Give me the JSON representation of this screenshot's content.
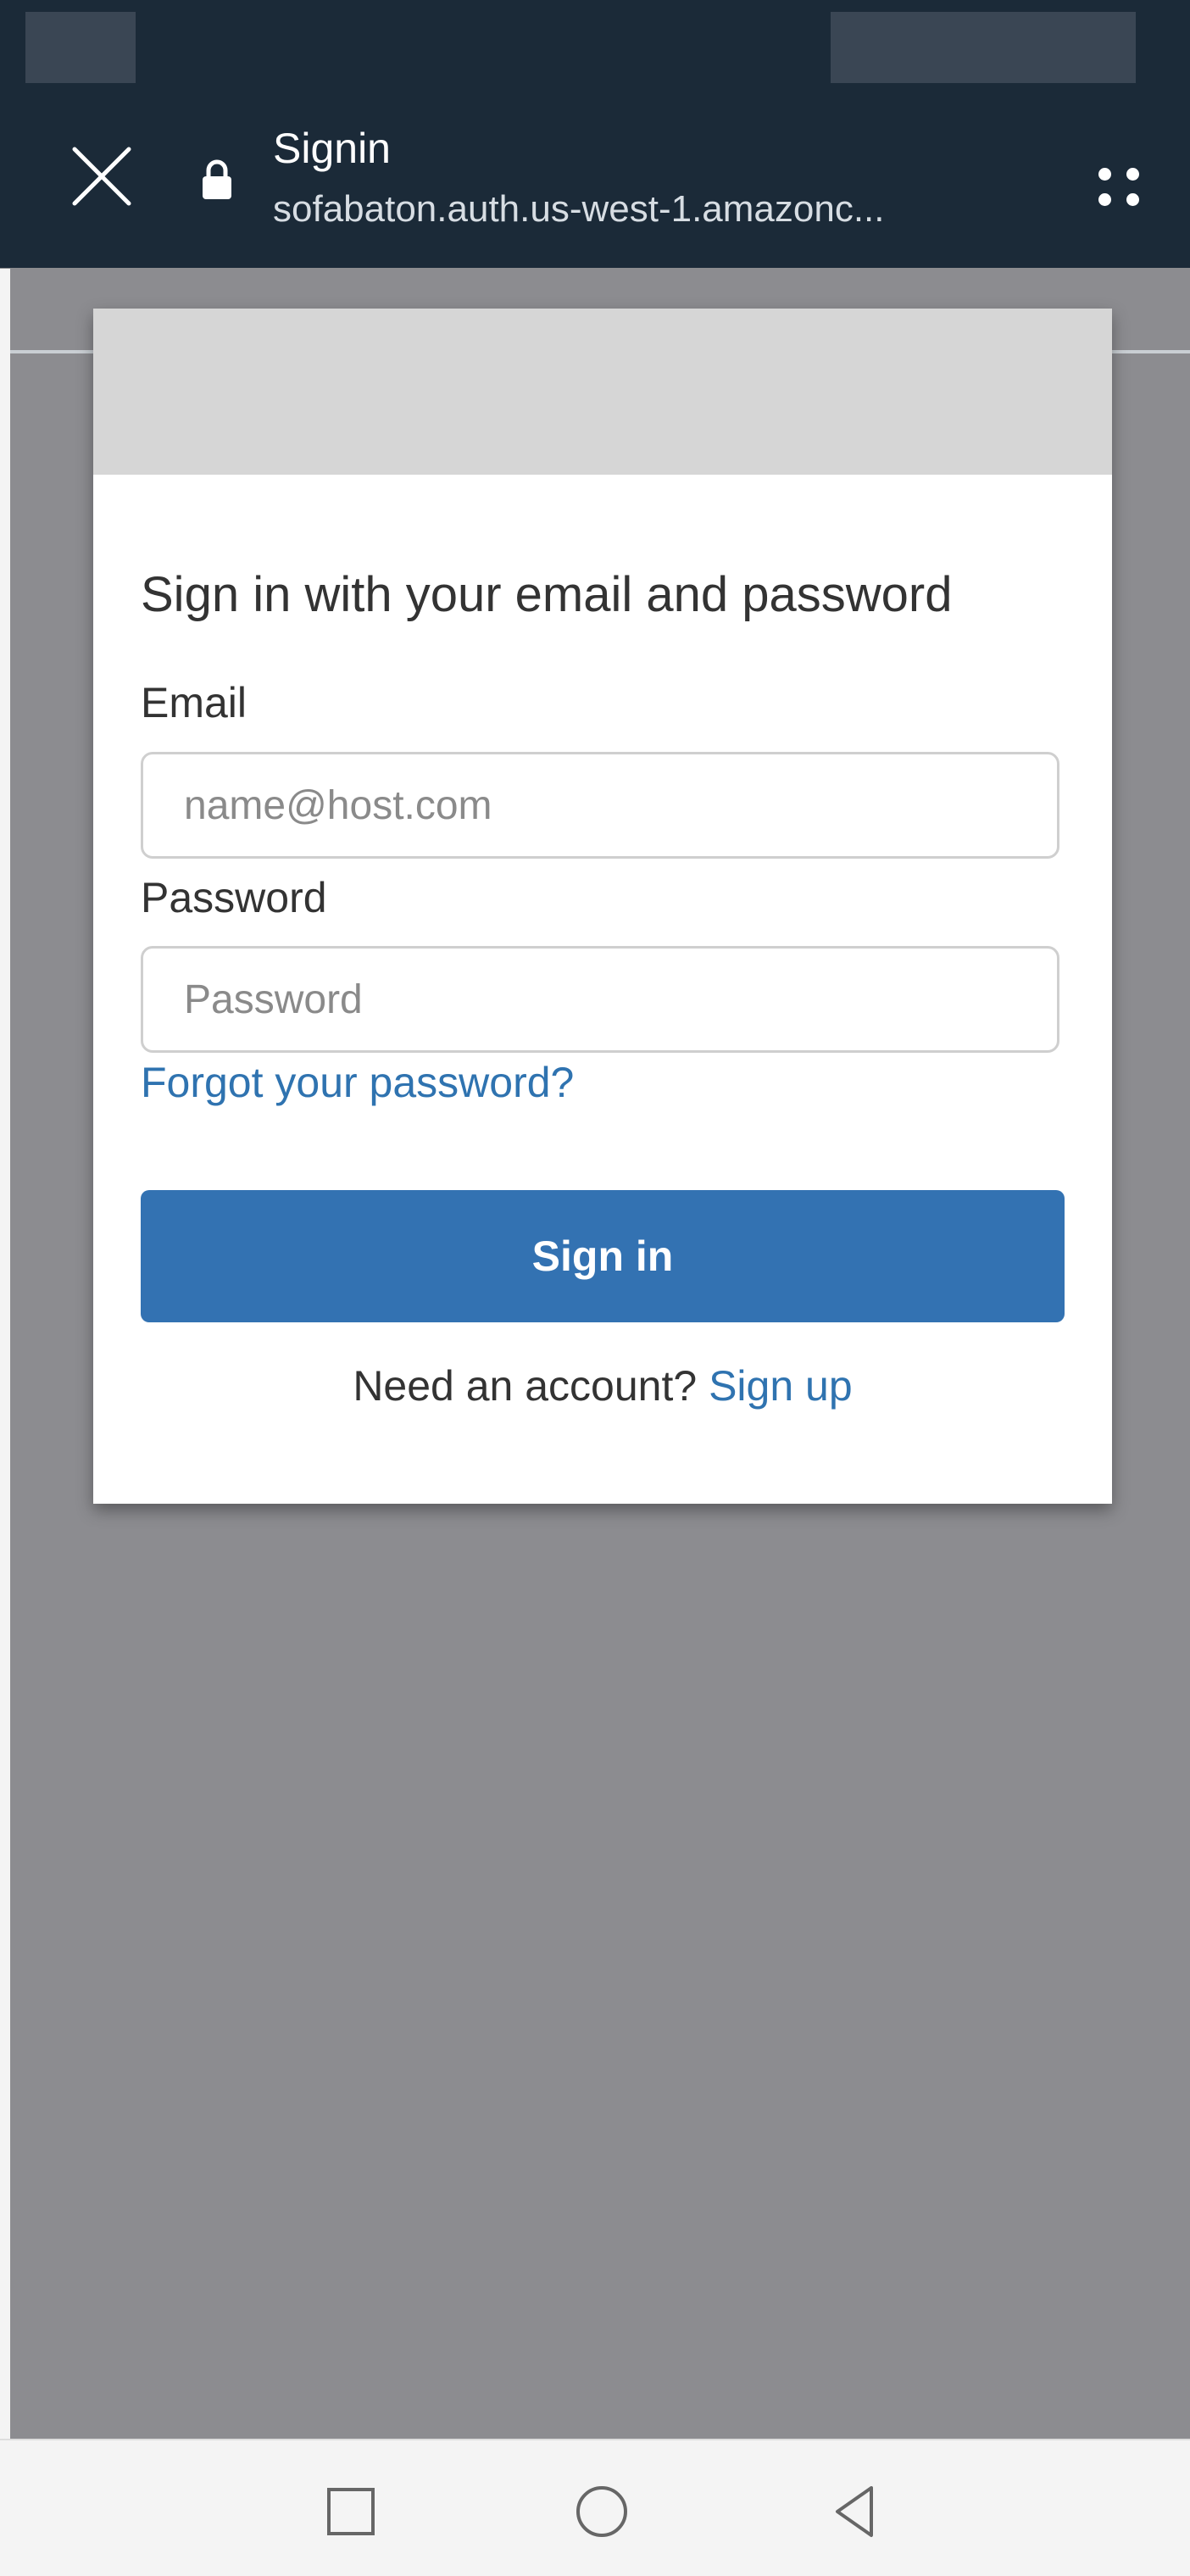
{
  "browser": {
    "title": "Signin",
    "url": "sofabaton.auth.us-west-1.amazonc..."
  },
  "form": {
    "heading": "Sign in with your email and password",
    "email_label": "Email",
    "email_placeholder": "name@host.com",
    "email_value": "",
    "password_label": "Password",
    "password_placeholder": "Password",
    "password_value": "",
    "forgot_link": "Forgot your password?",
    "signin_button": "Sign in",
    "signup_prompt": "Need an account?",
    "signup_link": "Sign up"
  },
  "icons": {
    "close": "close-icon",
    "lock": "lock-icon",
    "menu": "more-options-icon",
    "nav_recents": "square-icon",
    "nav_home": "circle-icon",
    "nav_back": "triangle-back-icon"
  },
  "colors": {
    "toolbar_bg": "#1b2a38",
    "accent": "#3372b2",
    "link": "#2f73b0",
    "overlay_bg": "#8c8c90",
    "banner_bg": "#d6d6d6"
  }
}
